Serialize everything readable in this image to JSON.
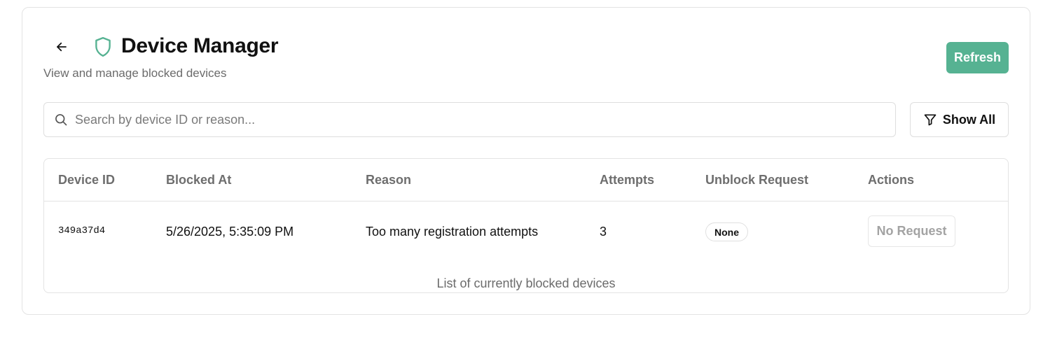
{
  "header": {
    "title": "Device Manager",
    "subtitle": "View and manage blocked devices",
    "refresh_label": "Refresh"
  },
  "search": {
    "placeholder": "Search by device ID or reason...",
    "value": ""
  },
  "filter": {
    "label": "Show All"
  },
  "table": {
    "columns": [
      "Device ID",
      "Blocked At",
      "Reason",
      "Attempts",
      "Unblock Request",
      "Actions"
    ],
    "rows": [
      {
        "device_id": "349a37d4",
        "blocked_at": "5/26/2025, 5:35:09 PM",
        "reason": "Too many registration attempts",
        "attempts": "3",
        "unblock_request": "None",
        "action_label": "No Request"
      }
    ],
    "caption": "List of currently blocked devices"
  },
  "icons": {
    "back": "arrow-left-icon",
    "brand": "shield-icon",
    "search": "search-icon",
    "filter": "filter-icon"
  },
  "colors": {
    "accent": "#56b292",
    "muted_text": "#6b6b6b",
    "border": "#e3e3e3"
  }
}
